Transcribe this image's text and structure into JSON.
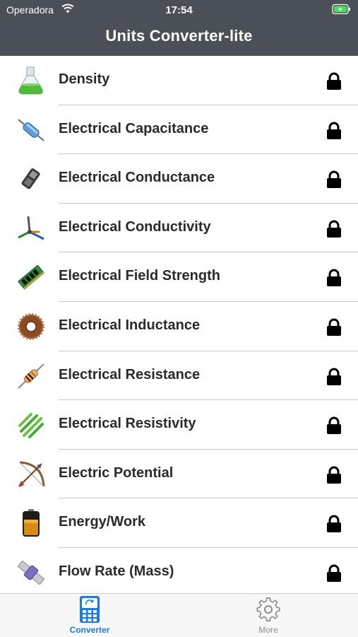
{
  "status_bar": {
    "carrier": "Operadora",
    "time": "17:54",
    "wifi_icon": "wifi-icon",
    "battery_icon": "battery-charging-icon"
  },
  "header": {
    "title": "Units Converter-lite"
  },
  "list": {
    "lock_icon": "lock-icon",
    "items": [
      {
        "label": "Density",
        "icon": "flask-icon"
      },
      {
        "label": "Electrical Capacitance",
        "icon": "capacitor-icon"
      },
      {
        "label": "Electrical Conductance",
        "icon": "chip-icon"
      },
      {
        "label": "Electrical Conductivity",
        "icon": "wires-icon"
      },
      {
        "label": "Electrical Field Strength",
        "icon": "circuit-board-icon"
      },
      {
        "label": "Electrical Inductance",
        "icon": "coil-icon"
      },
      {
        "label": "Electrical Resistance",
        "icon": "resistor-icon"
      },
      {
        "label": "Electrical Resistivity",
        "icon": "stripes-icon"
      },
      {
        "label": "Electric Potential",
        "icon": "bow-arrow-icon"
      },
      {
        "label": "Energy/Work",
        "icon": "battery-icon"
      },
      {
        "label": "Flow Rate (Mass)",
        "icon": "pipe-icon"
      }
    ]
  },
  "tabbar": {
    "tabs": [
      {
        "label": "Converter",
        "icon": "calculator-icon",
        "active": true
      },
      {
        "label": "More",
        "icon": "gear-icon",
        "active": false
      }
    ]
  },
  "colors": {
    "header_bg": "#4b5058",
    "accent": "#1a7be0",
    "tab_inactive": "#8e8e93"
  }
}
